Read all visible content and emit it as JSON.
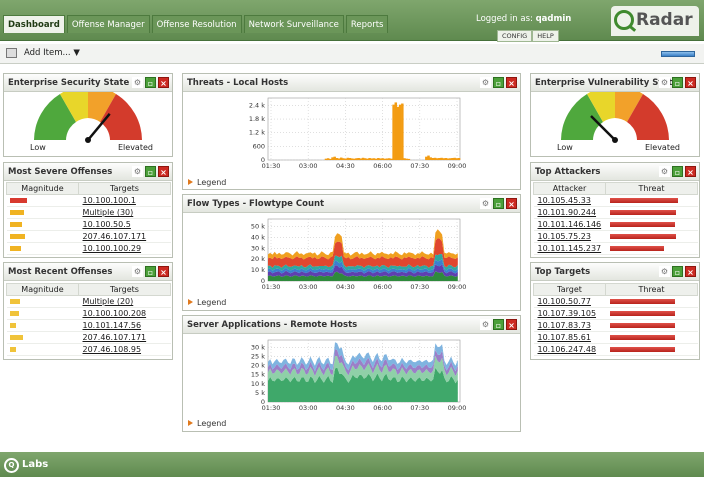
{
  "tabs": [
    "Dashboard",
    "Offense Manager",
    "Offense Resolution",
    "Network Surveillance",
    "Reports"
  ],
  "header": {
    "logged_prefix": "Logged in as:",
    "user": "qadmin",
    "config": "CONFIG",
    "help": "HELP",
    "brand": "Radar"
  },
  "toolbar": {
    "add_item": "Add Item... ▼"
  },
  "colors": {
    "brand_green": "#5f8a4f",
    "threat_red": "#c62c24",
    "flow_orange": "#f39c12"
  },
  "panels": {
    "ess": {
      "title": "Enterprise Security State",
      "low": "Low",
      "high": "Elevated",
      "needle_pct": 0.72
    },
    "evs": {
      "title": "Enterprise Vulnerability State",
      "low": "Low",
      "high": "Elevated",
      "needle_pct": 0.25
    },
    "severe": {
      "title": "Most Severe Offenses",
      "cols": [
        "Magnitude",
        "Targets"
      ],
      "rows": [
        {
          "target": "10.100.100.1",
          "mag": 0.85,
          "color": "#d83a2f"
        },
        {
          "target": "Multiple (30)",
          "mag": 0.7,
          "color": "#f0b322"
        },
        {
          "target": "10.100.50.5",
          "mag": 0.6,
          "color": "#f0b322"
        },
        {
          "target": "207.46.107.171",
          "mag": 0.75,
          "color": "#f0b322"
        },
        {
          "target": "10.100.100.29",
          "mag": 0.55,
          "color": "#f0b322"
        }
      ]
    },
    "recent": {
      "title": "Most Recent Offenses",
      "cols": [
        "Magnitude",
        "Targets"
      ],
      "rows": [
        {
          "target": "Multiple (20)",
          "mag": 0.5,
          "color": "#f0c33a"
        },
        {
          "target": "10.100.100.208",
          "mag": 0.45,
          "color": "#f0c33a"
        },
        {
          "target": "10.101.147.56",
          "mag": 0.3,
          "color": "#f0c33a"
        },
        {
          "target": "207.46.107.171",
          "mag": 0.65,
          "color": "#f0c33a"
        },
        {
          "target": "207.46.108.95",
          "mag": 0.3,
          "color": "#f0c33a"
        }
      ]
    },
    "threats": {
      "title": "Threats - Local Hosts",
      "legend": "Legend"
    },
    "flow": {
      "title": "Flow Types - Flowtype Count",
      "legend": "Legend"
    },
    "server": {
      "title": "Server Applications - Remote Hosts",
      "legend": "Legend"
    },
    "attackers": {
      "title": "Top Attackers",
      "cols": [
        "Attacker",
        "Threat"
      ],
      "rows": [
        {
          "ip": "10.105.45.33",
          "threat": 0.95
        },
        {
          "ip": "10.101.90.244",
          "threat": 0.92
        },
        {
          "ip": "10.101.146.146",
          "threat": 0.9
        },
        {
          "ip": "10.105.75.23",
          "threat": 0.92
        },
        {
          "ip": "10.101.145.237",
          "threat": 0.75
        }
      ]
    },
    "targets": {
      "title": "Top Targets",
      "cols": [
        "Target",
        "Threat"
      ],
      "rows": [
        {
          "ip": "10.100.50.77",
          "threat": 0.9
        },
        {
          "ip": "10.107.39.105",
          "threat": 0.9
        },
        {
          "ip": "10.107.83.73",
          "threat": 0.9
        },
        {
          "ip": "10.107.85.61",
          "threat": 0.9
        },
        {
          "ip": "10.106.247.48",
          "threat": 0.9
        }
      ]
    }
  },
  "footer": {
    "label": "Labs",
    "mark": "Q"
  },
  "chart_data": [
    {
      "type": "area",
      "title": "Threats - Local Hosts",
      "x": [
        "01:30",
        "03:00",
        "04:30",
        "06:00",
        "07:30",
        "09:00"
      ],
      "ytick_labels": [
        "0",
        "600",
        "1.2 k",
        "1.8 k",
        "2.4 k"
      ],
      "ylim": [
        0,
        2800
      ],
      "series": [
        {
          "color": "#f39c12",
          "values": [
            0,
            0,
            0,
            0,
            0,
            0,
            0,
            0,
            0,
            0,
            0,
            0,
            0,
            0,
            0,
            0,
            0,
            0,
            0,
            0,
            0,
            0,
            0,
            0,
            0,
            0,
            60,
            80,
            50,
            120,
            150,
            90,
            70,
            110,
            80,
            60,
            100,
            90,
            70,
            60,
            80,
            90,
            70,
            100,
            80,
            60,
            90,
            70,
            80,
            60,
            90,
            70,
            80,
            60,
            70,
            80,
            60,
            2500,
            2600,
            2400,
            2500,
            2550,
            80,
            60,
            50,
            0,
            0,
            0,
            0,
            0,
            0,
            0,
            150,
            200,
            120,
            90,
            100,
            80,
            90,
            100,
            80,
            90,
            70,
            80,
            90,
            100,
            80,
            90
          ]
        }
      ]
    },
    {
      "type": "area",
      "title": "Flow Types - Flowtype Count",
      "x": [
        "01:30",
        "03:00",
        "04:30",
        "06:00",
        "07:30",
        "09:00"
      ],
      "ytick_labels": [
        "0",
        "10 k",
        "20 k",
        "30 k",
        "40 k",
        "50 k"
      ],
      "ylim": [
        0,
        55000
      ],
      "stacked": true,
      "base": [
        24000,
        25000,
        23000,
        26000,
        24000,
        25000,
        23000,
        24000,
        26000,
        25000,
        24000,
        23000,
        25000,
        26000,
        24000,
        25000,
        23000,
        24000,
        25000,
        26000,
        24000,
        25000,
        23000,
        24000,
        26000,
        25000,
        24000,
        23000,
        25000,
        26000,
        40000,
        42000,
        41000,
        40000,
        26000,
        24000,
        25000,
        23000,
        24000,
        25000,
        26000,
        24000,
        25000,
        23000,
        24000,
        25000,
        26000,
        24000,
        23000,
        25000,
        24000,
        26000,
        25000,
        24000,
        23000,
        25000,
        24000,
        26000,
        25000,
        24000,
        23000,
        25000,
        24000,
        26000,
        25000,
        24000,
        23000,
        25000,
        24000,
        26000,
        25000,
        24000,
        23000,
        25000,
        24000,
        43000,
        45000,
        44000,
        42000,
        25000,
        24000,
        26000,
        25000,
        24000,
        23000,
        25000
      ],
      "series": [
        {
          "color": "#2e8a3c",
          "share": 0.18
        },
        {
          "color": "#5e3fb0",
          "share": 0.14
        },
        {
          "color": "#3a7fd0",
          "share": 0.1
        },
        {
          "color": "#2fa8a0",
          "share": 0.12
        },
        {
          "color": "#e0472f",
          "share": 0.3
        },
        {
          "color": "#f0a020",
          "share": 0.16
        }
      ]
    },
    {
      "type": "area",
      "title": "Server Applications - Remote Hosts",
      "x": [
        "01:30",
        "03:00",
        "04:30",
        "06:00",
        "07:30",
        "09:00"
      ],
      "ytick_labels": [
        "0",
        "5 k",
        "10 k",
        "15 k",
        "20 k",
        "25 k",
        "30 k"
      ],
      "ylim": [
        0,
        32000
      ],
      "stacked": true,
      "base": [
        20000,
        21000,
        20500,
        22000,
        21000,
        20000,
        21500,
        22000,
        21000,
        20500,
        21000,
        22000,
        21000,
        20000,
        21500,
        22000,
        21000,
        20500,
        21000,
        22000,
        21000,
        20000,
        21500,
        22000,
        21000,
        20500,
        21000,
        22000,
        21000,
        20000,
        29000,
        30000,
        29500,
        28000,
        22000,
        21000,
        20500,
        21000,
        23000,
        24000,
        25000,
        24000,
        23000,
        24000,
        25000,
        24000,
        23000,
        22000,
        23000,
        24000,
        23000,
        22000,
        23000,
        24000,
        23000,
        22000,
        21000,
        22000,
        21000,
        20000,
        21500,
        22000,
        21000,
        20500,
        21000,
        22000,
        21000,
        20000,
        21500,
        22000,
        21000,
        20500,
        21000,
        22000,
        21000,
        29000,
        30000,
        29500,
        28000,
        21000,
        20500,
        21000,
        22000,
        21000,
        20000,
        21000
      ],
      "series": [
        {
          "color": "#3fa86a",
          "share": 0.55
        },
        {
          "color": "#8fd0a8",
          "share": 0.2
        },
        {
          "color": "#9b7fc8",
          "share": 0.12
        },
        {
          "color": "#7fb4e0",
          "share": 0.13
        }
      ]
    }
  ]
}
